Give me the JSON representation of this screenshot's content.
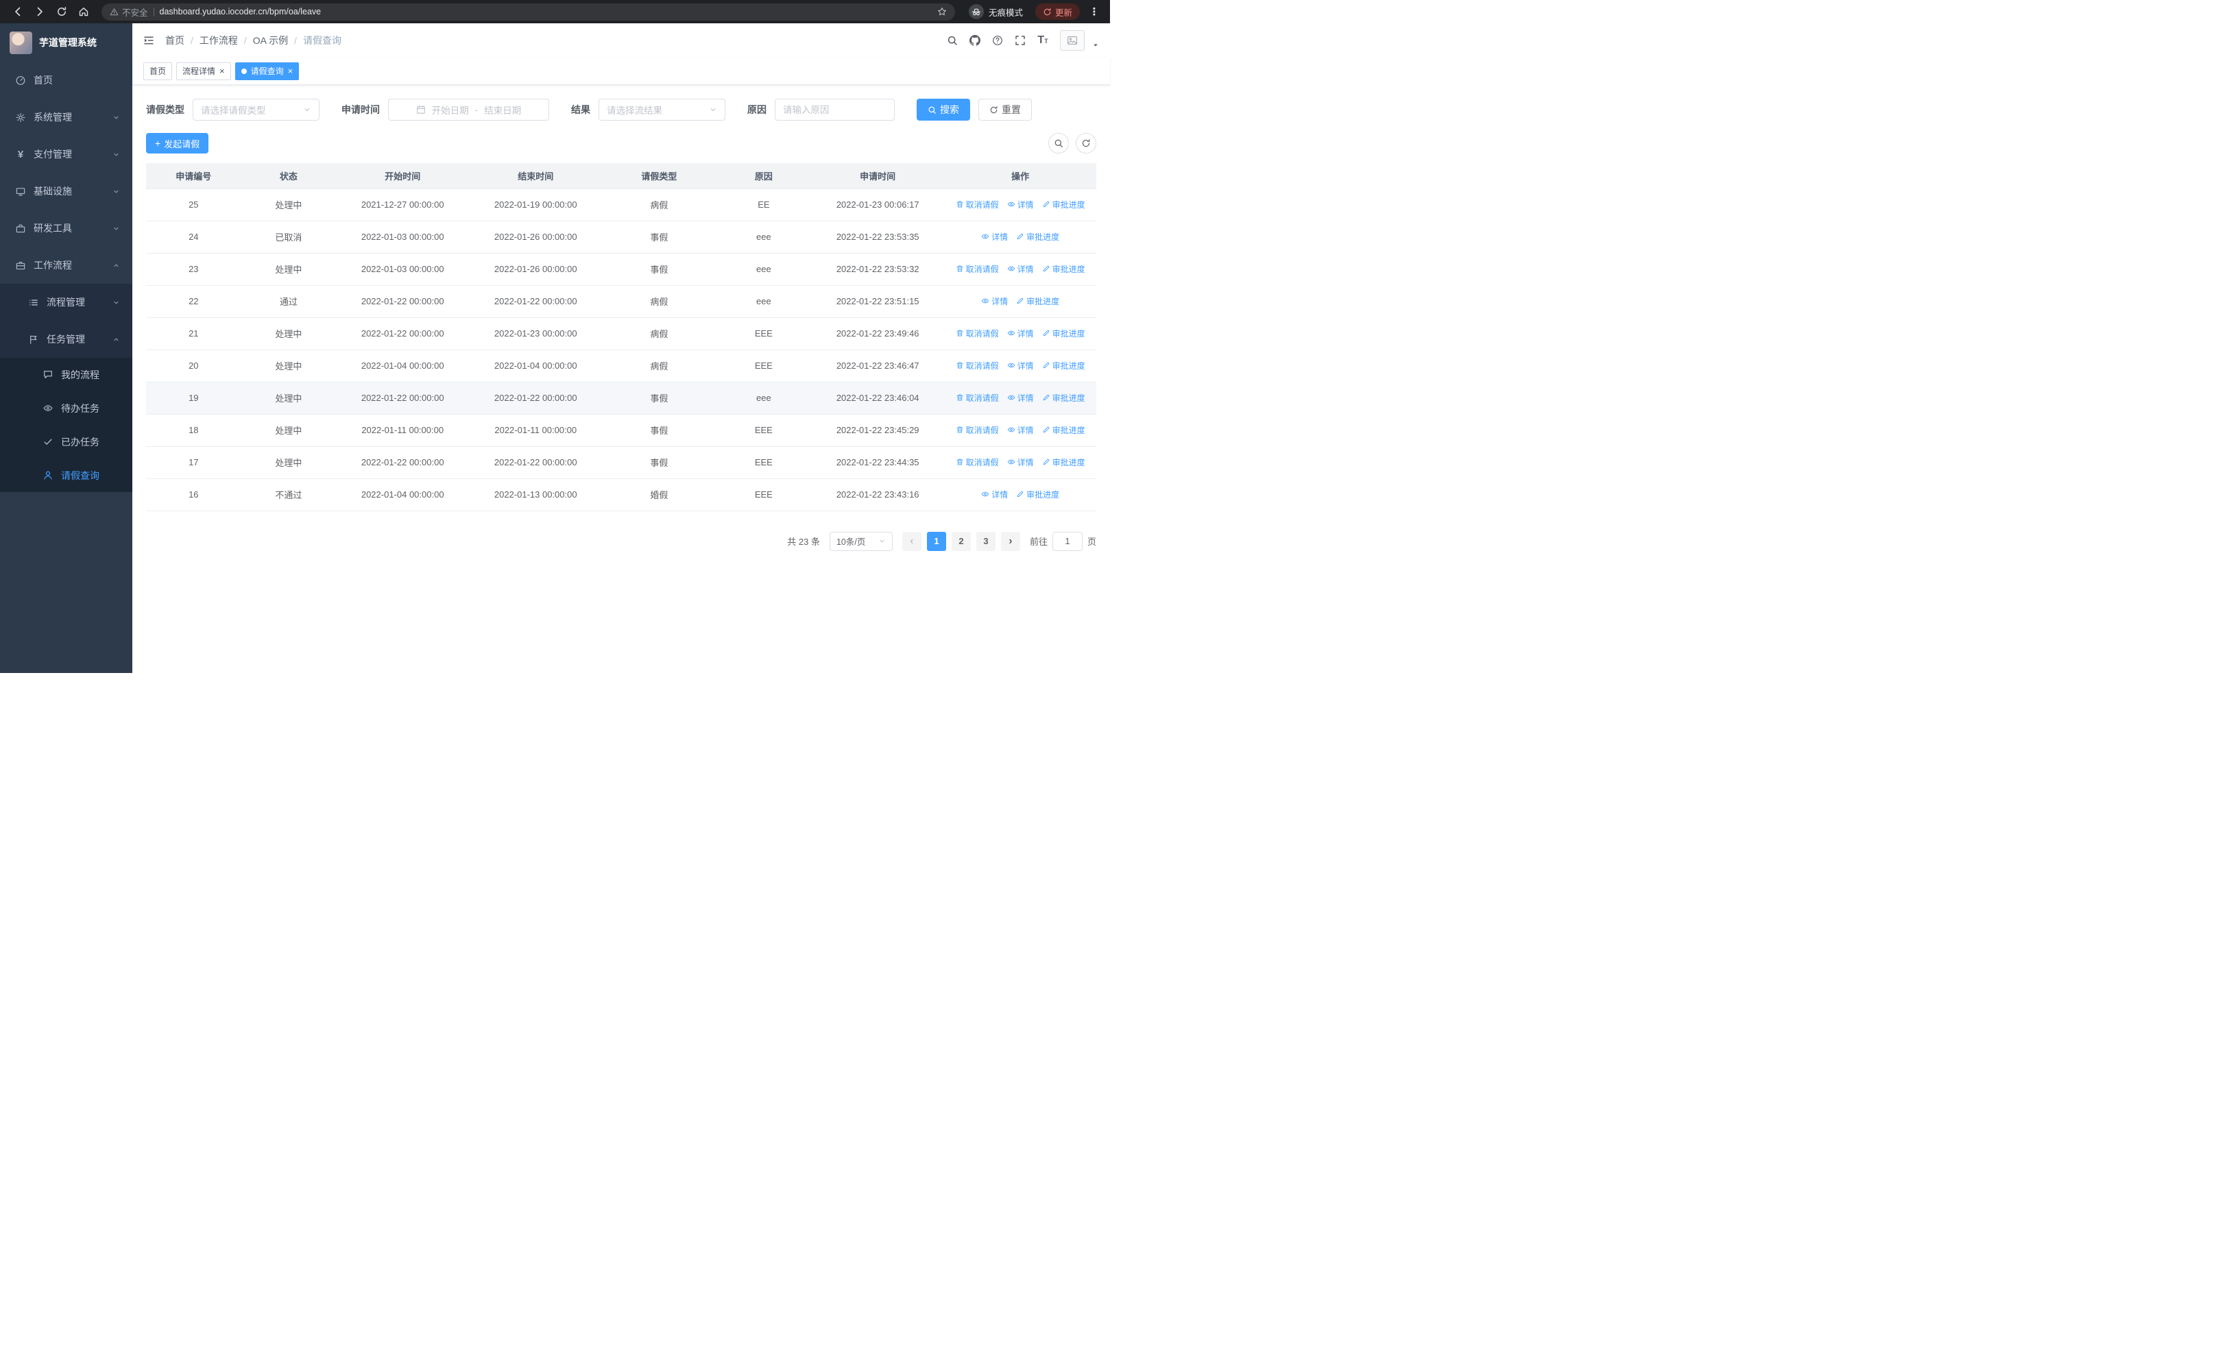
{
  "accent_color": "#409EFF",
  "browser": {
    "security_label": "不安全",
    "url": "dashboard.yudao.iocoder.cn/bpm/oa/leave",
    "incognito_label": "无痕模式",
    "update_label": "更新"
  },
  "sidebar": {
    "title": "芋道管理系统",
    "menu": [
      {
        "key": "home",
        "label": "首页",
        "icon": "dashboard",
        "level": 1
      },
      {
        "key": "system-management",
        "label": "系统管理",
        "icon": "gear",
        "level": 1,
        "chevron": "down"
      },
      {
        "key": "payment-management",
        "label": "支付管理",
        "icon": "yen",
        "level": 1,
        "chevron": "down"
      },
      {
        "key": "infrastructure",
        "label": "基础设施",
        "icon": "infra",
        "level": 1,
        "chevron": "down"
      },
      {
        "key": "dev-tools",
        "label": "研发工具",
        "icon": "tools",
        "level": 1,
        "chevron": "down"
      },
      {
        "key": "workflow",
        "label": "工作流程",
        "icon": "briefcase",
        "level": 1,
        "chevron": "up"
      },
      {
        "key": "process-management",
        "label": "流程管理",
        "icon": "list",
        "level": 2,
        "chevron": "down"
      },
      {
        "key": "task-management",
        "label": "任务管理",
        "icon": "flag",
        "level": 2,
        "chevron": "up"
      },
      {
        "key": "my-process",
        "label": "我的流程",
        "icon": "chat",
        "level": 3
      },
      {
        "key": "todo-tasks",
        "label": "待办任务",
        "icon": "eye",
        "level": 3
      },
      {
        "key": "done-tasks",
        "label": "已办任务",
        "icon": "check",
        "level": 3
      },
      {
        "key": "leave-query",
        "label": "请假查询",
        "icon": "user",
        "level": 3,
        "active": true
      }
    ]
  },
  "header": {
    "breadcrumb": [
      "首页",
      "工作流程",
      "OA 示例",
      "请假查询"
    ],
    "separator": "/"
  },
  "tabs": [
    {
      "key": "home",
      "label": "首页",
      "closable": false,
      "active": false
    },
    {
      "key": "process-detail",
      "label": "流程详情",
      "closable": true,
      "active": false
    },
    {
      "key": "leave-query",
      "label": "请假查询",
      "closable": true,
      "active": true
    }
  ],
  "filters": {
    "leave_type_label": "请假类型",
    "leave_type_placeholder": "请选择请假类型",
    "apply_time_label": "申请时间",
    "start_date_placeholder": "开始日期",
    "range_separator": "-",
    "end_date_placeholder": "结束日期",
    "result_label": "结果",
    "result_placeholder": "请选择流结果",
    "reason_label": "原因",
    "reason_placeholder": "请输入原因",
    "search_label": "搜索",
    "reset_label": "重置"
  },
  "toolbar": {
    "create_label": "发起请假"
  },
  "table": {
    "headers": [
      "申请编号",
      "状态",
      "开始时间",
      "结束时间",
      "请假类型",
      "原因",
      "申请时间",
      "操作"
    ],
    "action_labels": {
      "cancel": "取消请假",
      "detail": "详情",
      "progress": "审批进度"
    },
    "rows": [
      {
        "no": "25",
        "status": "处理中",
        "start": "2021-12-27 00:00:00",
        "end": "2022-01-19 00:00:00",
        "type": "病假",
        "reason": "EE",
        "apply_time": "2022-01-23 00:06:17",
        "cancelable": true
      },
      {
        "no": "24",
        "status": "已取消",
        "start": "2022-01-03 00:00:00",
        "end": "2022-01-26 00:00:00",
        "type": "事假",
        "reason": "eee",
        "apply_time": "2022-01-22 23:53:35",
        "cancelable": false
      },
      {
        "no": "23",
        "status": "处理中",
        "start": "2022-01-03 00:00:00",
        "end": "2022-01-26 00:00:00",
        "type": "事假",
        "reason": "eee",
        "apply_time": "2022-01-22 23:53:32",
        "cancelable": true
      },
      {
        "no": "22",
        "status": "通过",
        "start": "2022-01-22 00:00:00",
        "end": "2022-01-22 00:00:00",
        "type": "病假",
        "reason": "eee",
        "apply_time": "2022-01-22 23:51:15",
        "cancelable": false
      },
      {
        "no": "21",
        "status": "处理中",
        "start": "2022-01-22 00:00:00",
        "end": "2022-01-23 00:00:00",
        "type": "病假",
        "reason": "EEE",
        "apply_time": "2022-01-22 23:49:46",
        "cancelable": true
      },
      {
        "no": "20",
        "status": "处理中",
        "start": "2022-01-04 00:00:00",
        "end": "2022-01-04 00:00:00",
        "type": "病假",
        "reason": "EEE",
        "apply_time": "2022-01-22 23:46:47",
        "cancelable": true
      },
      {
        "no": "19",
        "status": "处理中",
        "start": "2022-01-22 00:00:00",
        "end": "2022-01-22 00:00:00",
        "type": "事假",
        "reason": "eee",
        "apply_time": "2022-01-22 23:46:04",
        "cancelable": true,
        "highlighted": true
      },
      {
        "no": "18",
        "status": "处理中",
        "start": "2022-01-11 00:00:00",
        "end": "2022-01-11 00:00:00",
        "type": "事假",
        "reason": "EEE",
        "apply_time": "2022-01-22 23:45:29",
        "cancelable": true
      },
      {
        "no": "17",
        "status": "处理中",
        "start": "2022-01-22 00:00:00",
        "end": "2022-01-22 00:00:00",
        "type": "事假",
        "reason": "EEE",
        "apply_time": "2022-01-22 23:44:35",
        "cancelable": true
      },
      {
        "no": "16",
        "status": "不通过",
        "start": "2022-01-04 00:00:00",
        "end": "2022-01-13 00:00:00",
        "type": "婚假",
        "reason": "EEE",
        "apply_time": "2022-01-22 23:43:16",
        "cancelable": false
      }
    ]
  },
  "pagination": {
    "total_label": "共 23 条",
    "page_size_label": "10条/页",
    "prev": "‹",
    "pages": [
      "1",
      "2",
      "3"
    ],
    "active_page": "1",
    "next": "›",
    "goto_prefix": "前往",
    "goto_value": "1",
    "goto_suffix": "页"
  }
}
